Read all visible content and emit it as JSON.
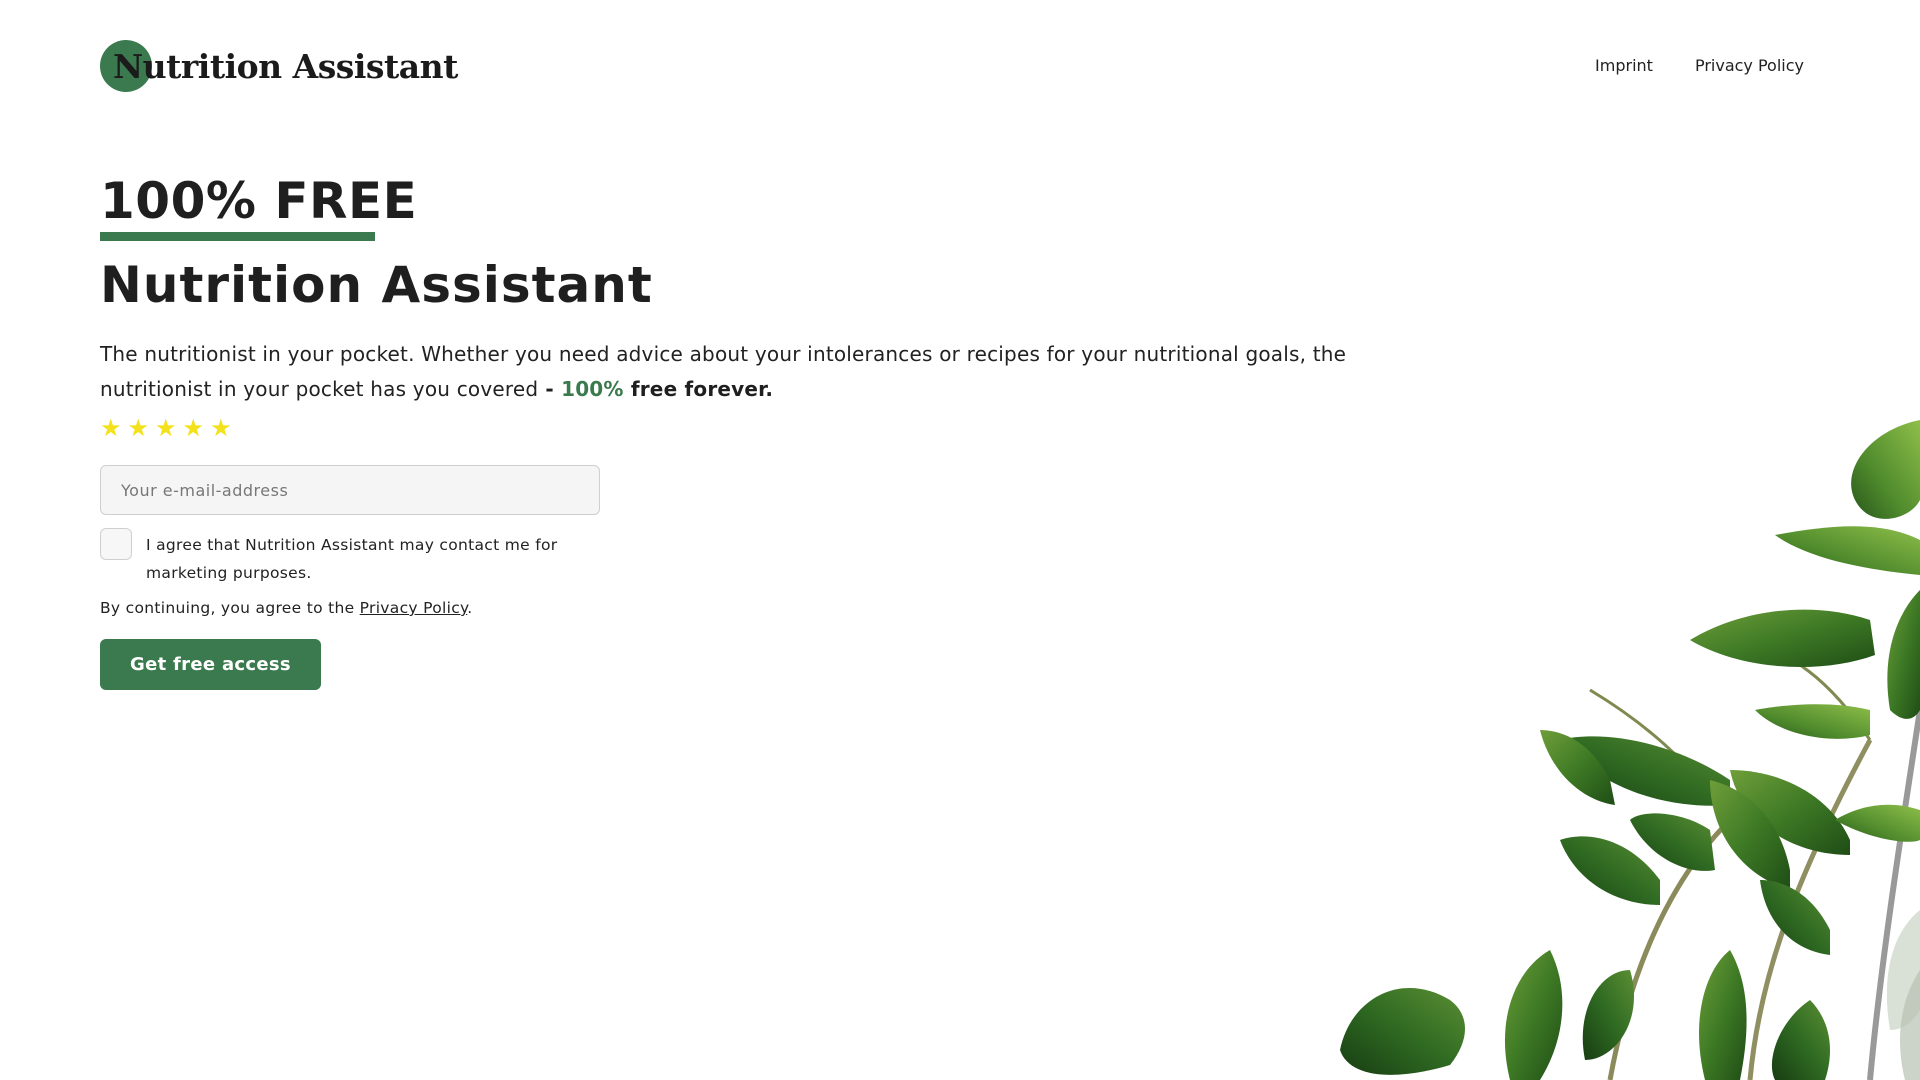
{
  "colors": {
    "brand_green": "#3a7a4e",
    "star_yellow": "#f3e21b",
    "text_dark": "#1f1f1f"
  },
  "header": {
    "logo_text": "Nutrition Assistant",
    "nav": [
      {
        "label": "Imprint"
      },
      {
        "label": "Privacy Policy"
      }
    ]
  },
  "hero": {
    "badge": "100% FREE",
    "title": "Nutrition Assistant",
    "description_plain": "The nutritionist in your pocket. Whether you need advice about your intolerances or recipes for your nutritional goals, the nutritionist in your pocket has you covered",
    "description_dash": " - ",
    "description_accent": "100%",
    "description_bold_end": " free forever.",
    "rating": {
      "value": 5,
      "max": 5,
      "icon": "star-icon"
    }
  },
  "form": {
    "email_placeholder": "Your e-mail-address",
    "email_value": "",
    "consent_text": "I agree that Nutrition Assistant may contact me for marketing purposes.",
    "consent_checked": false,
    "legal_prefix": "By continuing, you agree to the ",
    "legal_link": "Privacy Policy",
    "legal_suffix": ".",
    "cta_label": "Get free access"
  },
  "decoration": {
    "plant_image": "fiddle-leaf-plant-image"
  }
}
